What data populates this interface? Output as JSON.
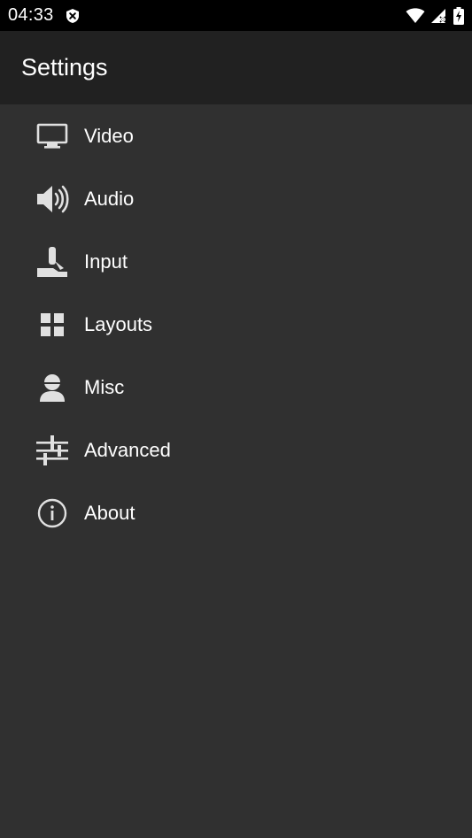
{
  "status_bar": {
    "time": "04:33",
    "left_icon": "shield-x-icon",
    "right_icons": [
      "wifi-icon",
      "signal-icon",
      "battery-charging-icon"
    ]
  },
  "app_bar": {
    "title": "Settings"
  },
  "menu": {
    "items": [
      {
        "label": "Video",
        "icon": "monitor-icon"
      },
      {
        "label": "Audio",
        "icon": "speaker-icon"
      },
      {
        "label": "Input",
        "icon": "joystick-icon"
      },
      {
        "label": "Layouts",
        "icon": "grid-icon"
      },
      {
        "label": "Misc",
        "icon": "person-icon"
      },
      {
        "label": "Advanced",
        "icon": "sliders-icon"
      },
      {
        "label": "About",
        "icon": "info-icon"
      }
    ]
  },
  "colors": {
    "status_bar_bg": "#000000",
    "app_bar_bg": "#212121",
    "content_bg": "#303030",
    "icon_color": "#e0e0e0",
    "text_color": "#ffffff"
  }
}
